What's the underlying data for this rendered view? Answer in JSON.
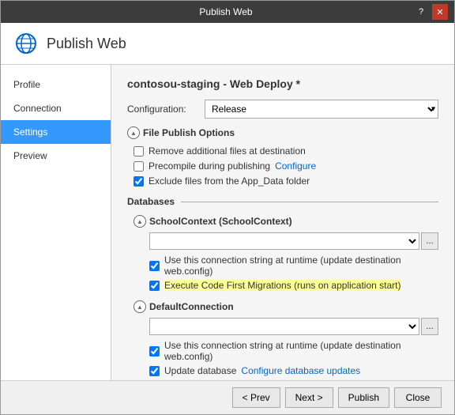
{
  "window": {
    "title": "Publish Web",
    "help_btn": "?",
    "close_btn": "✕"
  },
  "header": {
    "title": "Publish Web"
  },
  "sidebar": {
    "items": [
      {
        "id": "profile",
        "label": "Profile",
        "active": false
      },
      {
        "id": "connection",
        "label": "Connection",
        "active": false
      },
      {
        "id": "settings",
        "label": "Settings",
        "active": true
      },
      {
        "id": "preview",
        "label": "Preview",
        "active": false
      }
    ]
  },
  "content": {
    "page_title": "contosou-staging - Web Deploy *",
    "configuration_label": "Configuration:",
    "configuration_value": "Release",
    "file_publish_options": {
      "section_label": "File Publish Options",
      "options": [
        {
          "id": "remove_additional",
          "label": "Remove additional files at destination",
          "checked": false
        },
        {
          "id": "precompile",
          "label": "Precompile during publishing",
          "checked": false,
          "has_link": true,
          "link_text": "Configure"
        },
        {
          "id": "exclude_app_data",
          "label": "Exclude files from the App_Data folder",
          "checked": true
        }
      ]
    },
    "databases": {
      "label": "Databases",
      "school_context": {
        "label": "SchoolContext (SchoolContext)",
        "connection_string_label": "Use this connection string at runtime (update destination web.config)",
        "connection_string_checked": true,
        "migrations_label": "Execute Code First Migrations (runs on application start)",
        "migrations_checked": true,
        "migrations_highlighted": true
      },
      "default_connection": {
        "label": "DefaultConnection",
        "connection_string_label": "Use this connection string at runtime (update destination web.config)",
        "connection_string_checked": true,
        "update_db_label": "Update database",
        "update_db_link": "Configure database updates",
        "update_db_checked": true
      }
    }
  },
  "footer": {
    "prev_label": "< Prev",
    "next_label": "Next >",
    "publish_label": "Publish",
    "close_label": "Close"
  }
}
